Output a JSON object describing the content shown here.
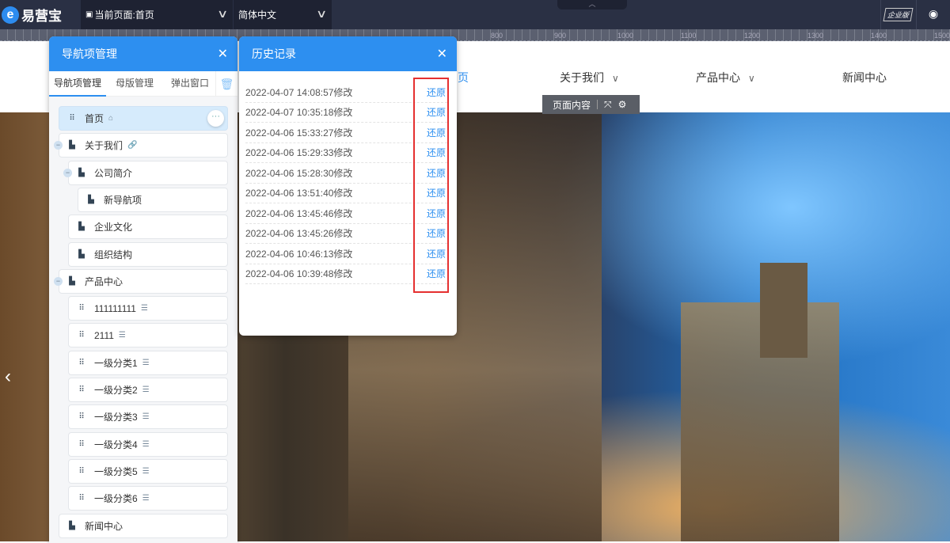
{
  "topbar": {
    "logo": "易营宝",
    "logo_mark": "e",
    "current_page": "当前页面:首页",
    "language": "简体中文",
    "edition": "企业版"
  },
  "ruler": {
    "ticks": [
      "800",
      "900",
      "1000",
      "1100",
      "1200",
      "1300",
      "1400",
      "1500"
    ]
  },
  "site_nav": [
    {
      "label": "页",
      "chevron": false
    },
    {
      "label": "关于我们",
      "chevron": true
    },
    {
      "label": "产品中心",
      "chevron": true
    },
    {
      "label": "新闻中心",
      "chevron": false
    }
  ],
  "toolbox": {
    "label": "页面内容"
  },
  "nav_panel": {
    "title": "导航项管理",
    "tabs": [
      "导航项管理",
      "母版管理",
      "弹出窗口"
    ],
    "items": [
      {
        "label": "首页",
        "icon": "grid",
        "suffix": "home"
      },
      {
        "label": "关于我们",
        "icon": "page",
        "suffix": "link",
        "collapse": true
      },
      {
        "label": "公司简介",
        "icon": "page",
        "collapse": true
      },
      {
        "label": "新导航项",
        "icon": "page"
      },
      {
        "label": "企业文化",
        "icon": "page"
      },
      {
        "label": "组织结构",
        "icon": "page"
      },
      {
        "label": "产品中心",
        "icon": "page",
        "collapse": true
      },
      {
        "label": "111111111",
        "icon": "grid",
        "suffix": "list"
      },
      {
        "label": "2111",
        "icon": "grid",
        "suffix": "list"
      },
      {
        "label": "一级分类1",
        "icon": "grid",
        "suffix": "list"
      },
      {
        "label": "一级分类2",
        "icon": "grid",
        "suffix": "list"
      },
      {
        "label": "一级分类3",
        "icon": "grid",
        "suffix": "list"
      },
      {
        "label": "一级分类4",
        "icon": "grid",
        "suffix": "list"
      },
      {
        "label": "一级分类5",
        "icon": "grid",
        "suffix": "list"
      },
      {
        "label": "一级分类6",
        "icon": "grid",
        "suffix": "list"
      },
      {
        "label": "新闻中心",
        "icon": "page"
      }
    ]
  },
  "history_panel": {
    "title": "历史记录",
    "restore_label": "还原",
    "records": [
      "2022-04-07 14:08:57修改",
      "2022-04-07 10:35:18修改",
      "2022-04-06 15:33:27修改",
      "2022-04-06 15:29:33修改",
      "2022-04-06 15:28:30修改",
      "2022-04-06 13:51:40修改",
      "2022-04-06 13:45:46修改",
      "2022-04-06 13:45:26修改",
      "2022-04-06 10:46:13修改",
      "2022-04-06 10:39:48修改"
    ]
  },
  "colors": {
    "accent": "#2d8ff0",
    "highlight_box": "#e53030",
    "topbar": "#2a3044"
  }
}
